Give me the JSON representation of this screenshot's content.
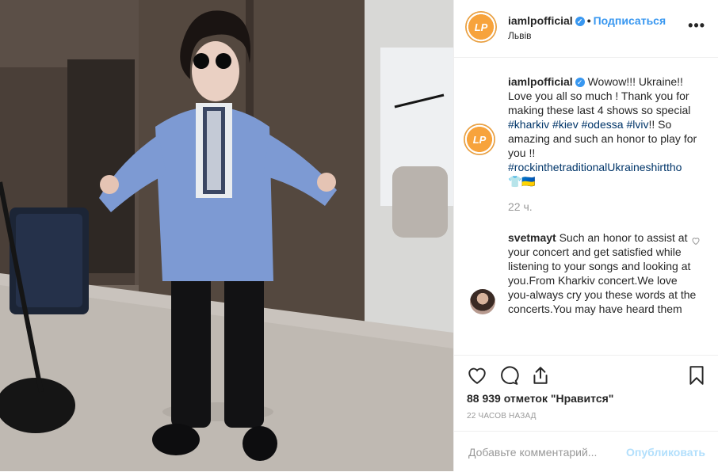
{
  "post": {
    "username": "iamlpofficial",
    "separator": "•",
    "follow_label": "Подписаться",
    "location": "Львів",
    "more_label": "•••",
    "avatar_text": "LP",
    "caption": {
      "username": "iamlpofficial",
      "text1": "Wowow!!! Ukraine!! Love you all so much ! Thank you for making these last 4 shows so special",
      "tags": [
        "#kharkiv",
        "#kiev",
        "#odessa",
        "#lviv"
      ],
      "text2": "!! So amazing and such an honor to play for you !!",
      "tag_long": "#rockinthetraditionalUkraineshirttho",
      "emoji": "👕🇺🇦"
    },
    "caption_time": "22 ч.",
    "comment": {
      "username": "svetmayt",
      "text": "Such an honor to assist at your concert and get satisfied while listening to your songs and looking at you.From Kharkiv concert.We love you-always cry you these words at the concerts.You may have heard them"
    },
    "likes": "88 939 отметок \"Нравится\"",
    "time_ago": "22 ЧАСОВ НАЗАД",
    "add_comment_placeholder": "Добавьте комментарий...",
    "publish_label": "Опубликовать"
  },
  "icons": {
    "like": "heart-icon",
    "comment": "comment-icon",
    "share": "share-icon",
    "save": "bookmark-icon",
    "verified": "verified-badge-icon",
    "comment_like": "small-heart-icon"
  },
  "colors": {
    "link": "#3897f0",
    "hashtag": "#003569",
    "muted": "#999999",
    "avatar": "#f7a33c"
  }
}
